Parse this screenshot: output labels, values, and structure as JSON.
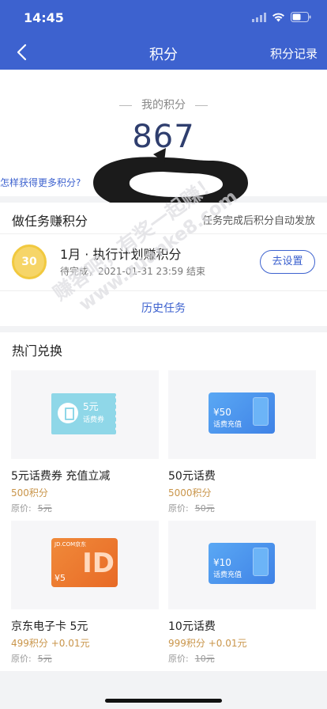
{
  "status_bar": {
    "time": "14:45"
  },
  "nav": {
    "title": "积分",
    "right_link": "积分记录"
  },
  "points": {
    "label": "我的积分",
    "value": "867",
    "link": "怎样获得更多积分?"
  },
  "tasks": {
    "title": "做任务赚积分",
    "note": "任务完成后积分自动发放",
    "items": [
      {
        "badge": "30",
        "title": "1月 · 执行计划赚积分",
        "status": "待完成，2021-01-31 23:59 结束",
        "button": "去设置"
      }
    ],
    "history": "历史任务"
  },
  "exchange": {
    "title": "热门兑换",
    "items": [
      {
        "name": "5元话费券 充值立减",
        "price": "500积分",
        "orig_label": "原价:",
        "orig": "5元",
        "thumb": {
          "kind": "coupon",
          "amount": "5元",
          "label": "话费券"
        }
      },
      {
        "name": "50元话费",
        "price": "5000积分",
        "orig_label": "原价:",
        "orig": "50元",
        "thumb": {
          "kind": "card",
          "amount": "¥50",
          "label": "话费充值"
        }
      },
      {
        "name": "京东电子卡 5元",
        "price": "499积分 +0.01元",
        "orig_label": "原价:",
        "orig": "5元",
        "thumb": {
          "kind": "jd",
          "top": "JD.COM京东",
          "amount": "¥5",
          "mark": "ID"
        }
      },
      {
        "name": "10元话费",
        "price": "999积分 +0.01元",
        "orig_label": "原价:",
        "orig": "10元",
        "thumb": {
          "kind": "card",
          "amount": "¥10",
          "label": "话费充值"
        }
      }
    ]
  },
  "watermark": {
    "line1": "赚客吧，有奖一起赚！",
    "line2": "www.zuanke8.com"
  },
  "colors": {
    "brand": "#3d62cf",
    "price": "#c9954a",
    "coin": "#f6d568"
  }
}
